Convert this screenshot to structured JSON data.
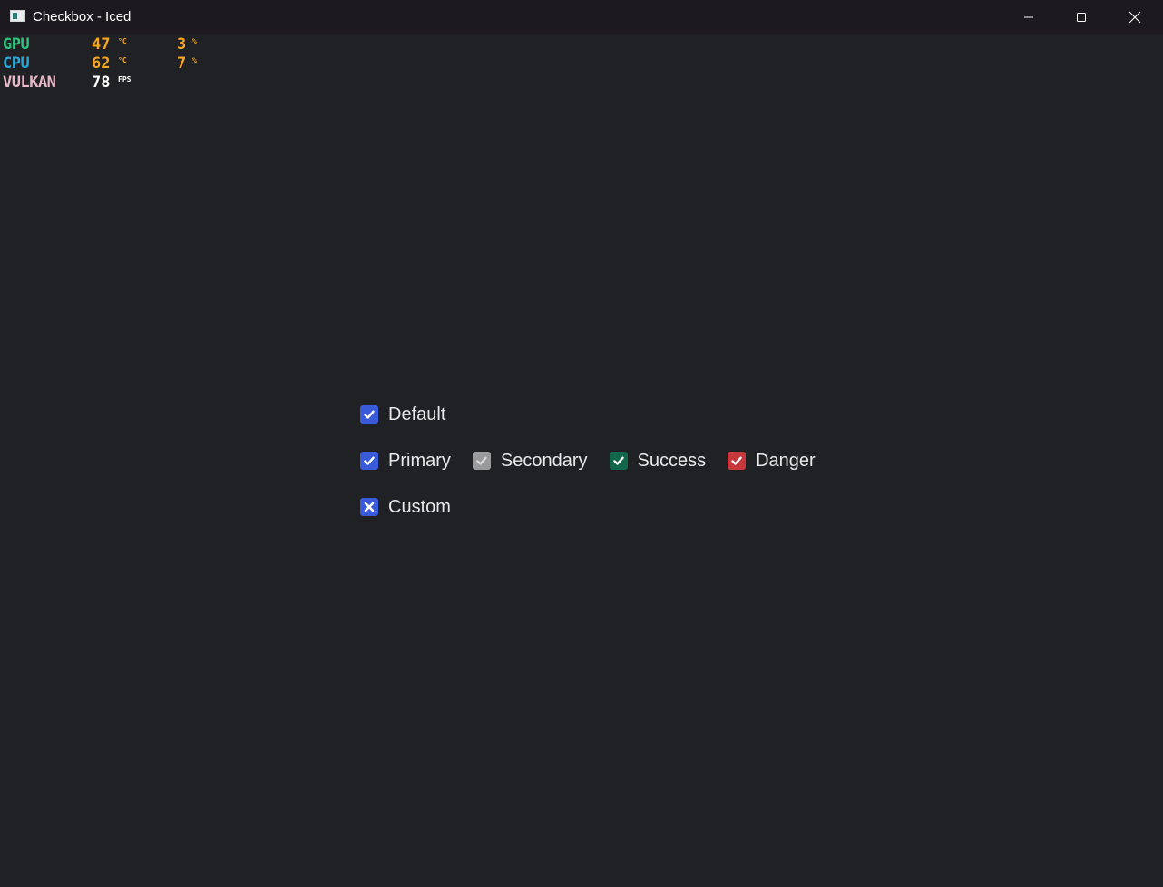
{
  "window": {
    "title": "Checkbox - Iced",
    "colors": {
      "background": "#202124",
      "titlebar": "#1c1a1e"
    }
  },
  "hud": {
    "rows": [
      {
        "label": "GPU",
        "label_color": "#2ec27e",
        "value1": "47",
        "unit1": "°C",
        "value2": "3",
        "unit2": "%"
      },
      {
        "label": "CPU",
        "label_color": "#2aa6d6",
        "value1": "62",
        "unit1": "°C",
        "value2": "7",
        "unit2": "%"
      },
      {
        "label": "VULKAN",
        "label_color": "#e7b8c8",
        "value1": "78",
        "unit1": "FPS",
        "value2": "",
        "unit2": ""
      }
    ],
    "value_color": "#f5a623",
    "fps_color": "#ffffff"
  },
  "checkboxes": {
    "default": {
      "label": "Default",
      "checked": true,
      "color": "#3a5bd9",
      "mark": "check"
    },
    "primary": {
      "label": "Primary",
      "checked": true,
      "color": "#3a5bd9",
      "mark": "check"
    },
    "secondary": {
      "label": "Secondary",
      "checked": true,
      "color": "#9a9a9c",
      "mark": "check"
    },
    "success": {
      "label": "Success",
      "checked": true,
      "color": "#13664a",
      "mark": "check"
    },
    "danger": {
      "label": "Danger",
      "checked": true,
      "color": "#c6383c",
      "mark": "check"
    },
    "custom": {
      "label": "Custom",
      "checked": true,
      "color": "#3a5bd9",
      "mark": "x"
    }
  }
}
